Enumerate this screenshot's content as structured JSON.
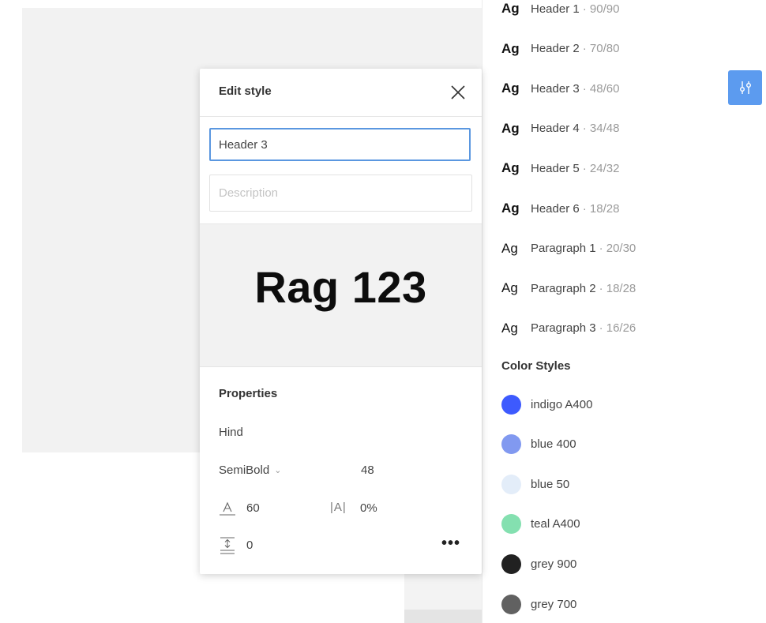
{
  "dialog": {
    "title": "Edit style",
    "name_value": "Header 3",
    "description_placeholder": "Description",
    "preview_text": "Rag 123",
    "properties_title": "Properties",
    "font_family": "Hind",
    "font_weight": "SemiBold",
    "font_size": "48",
    "line_height": "60",
    "letter_spacing_icon": "|A|",
    "letter_spacing": "0%",
    "paragraph_spacing": "0",
    "more_label": "•••"
  },
  "text_styles": [
    {
      "ag": "Ag",
      "name": "Header 1",
      "meta": "· 90/90",
      "bold": true
    },
    {
      "ag": "Ag",
      "name": "Header 2",
      "meta": "· 70/80",
      "bold": true
    },
    {
      "ag": "Ag",
      "name": "Header 3",
      "meta": "· 48/60",
      "bold": true
    },
    {
      "ag": "Ag",
      "name": "Header 4",
      "meta": "· 34/48",
      "bold": true
    },
    {
      "ag": "Ag",
      "name": "Header 5",
      "meta": "· 24/32",
      "bold": true
    },
    {
      "ag": "Ag",
      "name": "Header 6",
      "meta": "· 18/28",
      "bold": true
    },
    {
      "ag": "Ag",
      "name": "Paragraph 1",
      "meta": "· 20/30",
      "bold": false
    },
    {
      "ag": "Ag",
      "name": "Paragraph 2",
      "meta": "· 18/28",
      "bold": false
    },
    {
      "ag": "Ag",
      "name": "Paragraph 3",
      "meta": "· 16/26",
      "bold": false
    }
  ],
  "color_styles_title": "Color Styles",
  "color_styles": [
    {
      "name": "indigo A400",
      "color": "#3d5afe"
    },
    {
      "name": "blue 400",
      "color": "#8199f0"
    },
    {
      "name": "blue 50",
      "color": "#e3edf9"
    },
    {
      "name": "teal A400",
      "color": "#84e0b0"
    },
    {
      "name": "grey 900",
      "color": "#212121"
    },
    {
      "name": "grey 700",
      "color": "#616161"
    }
  ],
  "colors": {
    "accent": "#5c9bef",
    "input_focus": "#5a97e0"
  },
  "icons": {
    "close": "close-icon",
    "filter": "sliders-icon",
    "line_height": "line-height-icon",
    "paragraph_spacing": "paragraph-spacing-icon"
  }
}
